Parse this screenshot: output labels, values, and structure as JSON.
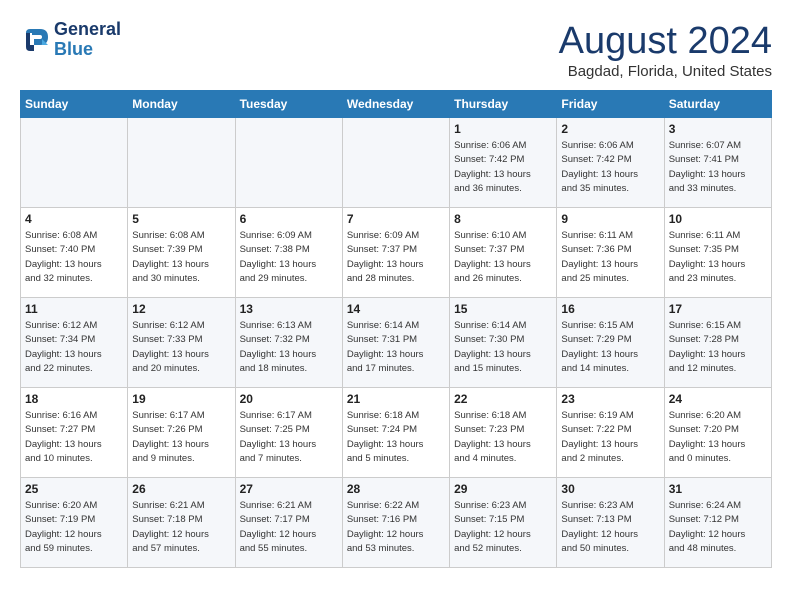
{
  "header": {
    "logo_line1": "General",
    "logo_line2": "Blue",
    "month": "August 2024",
    "location": "Bagdad, Florida, United States"
  },
  "weekdays": [
    "Sunday",
    "Monday",
    "Tuesday",
    "Wednesday",
    "Thursday",
    "Friday",
    "Saturday"
  ],
  "weeks": [
    [
      {
        "day": "",
        "info": ""
      },
      {
        "day": "",
        "info": ""
      },
      {
        "day": "",
        "info": ""
      },
      {
        "day": "",
        "info": ""
      },
      {
        "day": "1",
        "info": "Sunrise: 6:06 AM\nSunset: 7:42 PM\nDaylight: 13 hours\nand 36 minutes."
      },
      {
        "day": "2",
        "info": "Sunrise: 6:06 AM\nSunset: 7:42 PM\nDaylight: 13 hours\nand 35 minutes."
      },
      {
        "day": "3",
        "info": "Sunrise: 6:07 AM\nSunset: 7:41 PM\nDaylight: 13 hours\nand 33 minutes."
      }
    ],
    [
      {
        "day": "4",
        "info": "Sunrise: 6:08 AM\nSunset: 7:40 PM\nDaylight: 13 hours\nand 32 minutes."
      },
      {
        "day": "5",
        "info": "Sunrise: 6:08 AM\nSunset: 7:39 PM\nDaylight: 13 hours\nand 30 minutes."
      },
      {
        "day": "6",
        "info": "Sunrise: 6:09 AM\nSunset: 7:38 PM\nDaylight: 13 hours\nand 29 minutes."
      },
      {
        "day": "7",
        "info": "Sunrise: 6:09 AM\nSunset: 7:37 PM\nDaylight: 13 hours\nand 28 minutes."
      },
      {
        "day": "8",
        "info": "Sunrise: 6:10 AM\nSunset: 7:37 PM\nDaylight: 13 hours\nand 26 minutes."
      },
      {
        "day": "9",
        "info": "Sunrise: 6:11 AM\nSunset: 7:36 PM\nDaylight: 13 hours\nand 25 minutes."
      },
      {
        "day": "10",
        "info": "Sunrise: 6:11 AM\nSunset: 7:35 PM\nDaylight: 13 hours\nand 23 minutes."
      }
    ],
    [
      {
        "day": "11",
        "info": "Sunrise: 6:12 AM\nSunset: 7:34 PM\nDaylight: 13 hours\nand 22 minutes."
      },
      {
        "day": "12",
        "info": "Sunrise: 6:12 AM\nSunset: 7:33 PM\nDaylight: 13 hours\nand 20 minutes."
      },
      {
        "day": "13",
        "info": "Sunrise: 6:13 AM\nSunset: 7:32 PM\nDaylight: 13 hours\nand 18 minutes."
      },
      {
        "day": "14",
        "info": "Sunrise: 6:14 AM\nSunset: 7:31 PM\nDaylight: 13 hours\nand 17 minutes."
      },
      {
        "day": "15",
        "info": "Sunrise: 6:14 AM\nSunset: 7:30 PM\nDaylight: 13 hours\nand 15 minutes."
      },
      {
        "day": "16",
        "info": "Sunrise: 6:15 AM\nSunset: 7:29 PM\nDaylight: 13 hours\nand 14 minutes."
      },
      {
        "day": "17",
        "info": "Sunrise: 6:15 AM\nSunset: 7:28 PM\nDaylight: 13 hours\nand 12 minutes."
      }
    ],
    [
      {
        "day": "18",
        "info": "Sunrise: 6:16 AM\nSunset: 7:27 PM\nDaylight: 13 hours\nand 10 minutes."
      },
      {
        "day": "19",
        "info": "Sunrise: 6:17 AM\nSunset: 7:26 PM\nDaylight: 13 hours\nand 9 minutes."
      },
      {
        "day": "20",
        "info": "Sunrise: 6:17 AM\nSunset: 7:25 PM\nDaylight: 13 hours\nand 7 minutes."
      },
      {
        "day": "21",
        "info": "Sunrise: 6:18 AM\nSunset: 7:24 PM\nDaylight: 13 hours\nand 5 minutes."
      },
      {
        "day": "22",
        "info": "Sunrise: 6:18 AM\nSunset: 7:23 PM\nDaylight: 13 hours\nand 4 minutes."
      },
      {
        "day": "23",
        "info": "Sunrise: 6:19 AM\nSunset: 7:22 PM\nDaylight: 13 hours\nand 2 minutes."
      },
      {
        "day": "24",
        "info": "Sunrise: 6:20 AM\nSunset: 7:20 PM\nDaylight: 13 hours\nand 0 minutes."
      }
    ],
    [
      {
        "day": "25",
        "info": "Sunrise: 6:20 AM\nSunset: 7:19 PM\nDaylight: 12 hours\nand 59 minutes."
      },
      {
        "day": "26",
        "info": "Sunrise: 6:21 AM\nSunset: 7:18 PM\nDaylight: 12 hours\nand 57 minutes."
      },
      {
        "day": "27",
        "info": "Sunrise: 6:21 AM\nSunset: 7:17 PM\nDaylight: 12 hours\nand 55 minutes."
      },
      {
        "day": "28",
        "info": "Sunrise: 6:22 AM\nSunset: 7:16 PM\nDaylight: 12 hours\nand 53 minutes."
      },
      {
        "day": "29",
        "info": "Sunrise: 6:23 AM\nSunset: 7:15 PM\nDaylight: 12 hours\nand 52 minutes."
      },
      {
        "day": "30",
        "info": "Sunrise: 6:23 AM\nSunset: 7:13 PM\nDaylight: 12 hours\nand 50 minutes."
      },
      {
        "day": "31",
        "info": "Sunrise: 6:24 AM\nSunset: 7:12 PM\nDaylight: 12 hours\nand 48 minutes."
      }
    ]
  ]
}
